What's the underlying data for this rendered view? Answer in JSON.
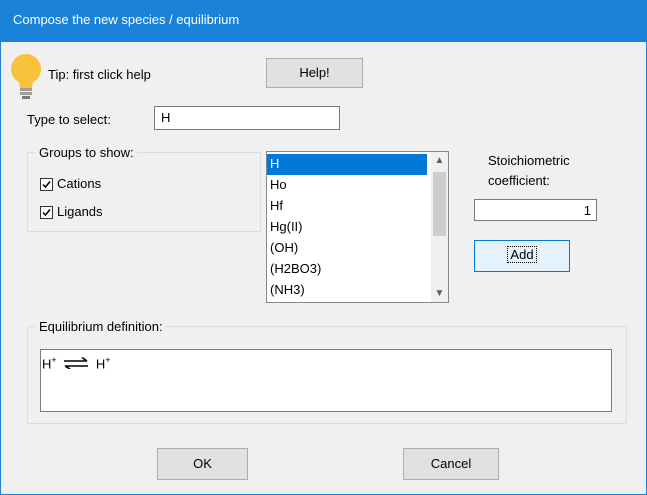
{
  "window": {
    "title": "Compose the new species / equilibrium"
  },
  "tip": {
    "icon": "lightbulb-icon",
    "text": "Tip: first click help"
  },
  "help_button": {
    "label": "Help!"
  },
  "select": {
    "label": "Type to select:",
    "value": "H"
  },
  "groups": {
    "legend": "Groups to show:",
    "cations": {
      "label": "Cations",
      "checked": true
    },
    "ligands": {
      "label": "Ligands",
      "checked": true
    }
  },
  "species_list": {
    "items": [
      "H",
      "Ho",
      "Hf",
      "Hg(II)",
      "(OH)",
      "(H2BO3)",
      "(NH3)"
    ],
    "selected_index": 0
  },
  "stoich": {
    "label_line1": "Stoichiometric",
    "label_line2": "coefficient:",
    "value": "1"
  },
  "add_button": {
    "label": "Add"
  },
  "equilibrium": {
    "legend": "Equilibrium definition:",
    "left": "H",
    "left_charge": "+",
    "arrow": "equilibrium-arrows-icon",
    "right": "H",
    "right_charge": "+"
  },
  "ok_button": {
    "label": "OK"
  },
  "cancel_button": {
    "label": "Cancel"
  },
  "colors": {
    "titlebar": "#1a82d9",
    "selection": "#0078d7",
    "dialog_bg": "#f0f0f0"
  }
}
